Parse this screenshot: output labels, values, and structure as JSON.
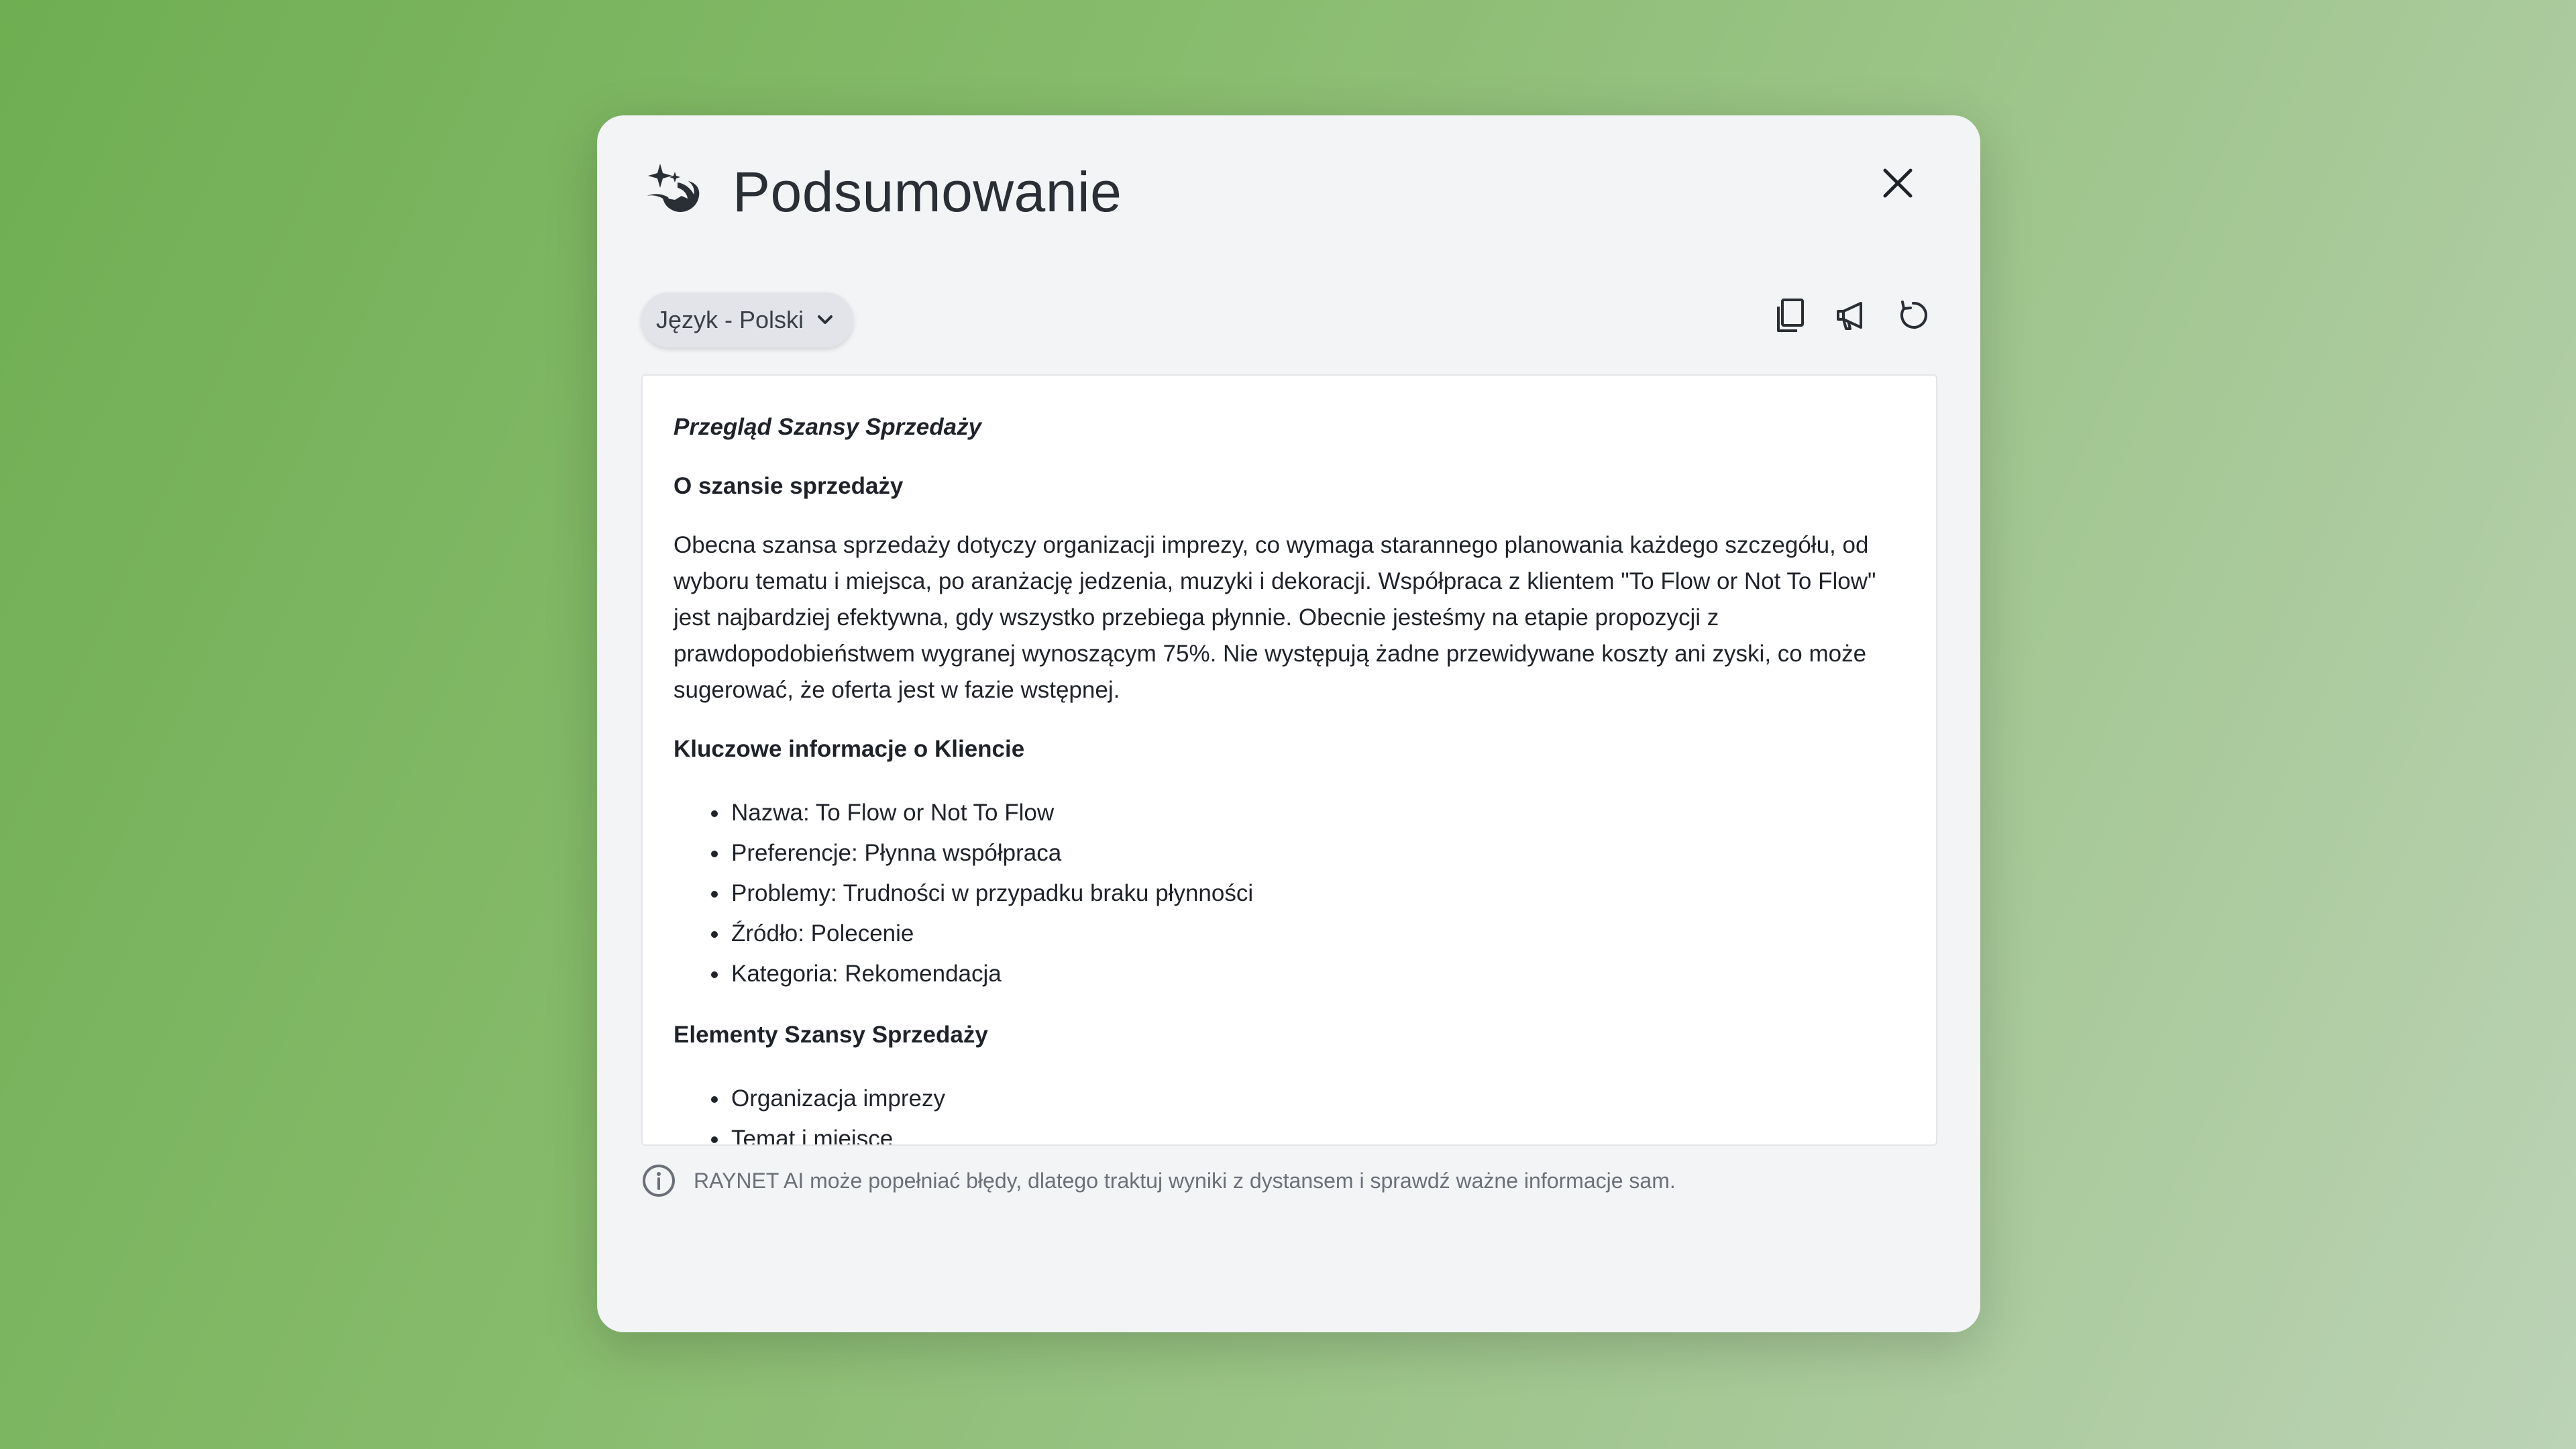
{
  "dialog": {
    "title": "Podsumowanie",
    "icons": {
      "title": "ai-sparkle-icon",
      "close": "close-icon"
    }
  },
  "toolbar": {
    "language_label": "Język - Polski",
    "icons": [
      "copy-icon",
      "megaphone-icon",
      "refresh-icon"
    ]
  },
  "summary": {
    "doc_title": "Przegląd Szansy Sprzedaży",
    "section1_heading": "O szansie sprzedaży",
    "section1_text": "Obecna szansa sprzedaży dotyczy organizacji imprezy, co wymaga starannego planowania każdego szczegółu, od wyboru tematu i miejsca, po aranżację jedzenia, muzyki i dekoracji. Współpraca z klientem \"To Flow or Not To Flow\" jest najbardziej efektywna, gdy wszystko przebiega płynnie. Obecnie jesteśmy na etapie propozycji z prawdopodobieństwem wygranej wynoszącym 75%. Nie występują żadne przewidywane koszty ani zyski, co może sugerować, że oferta jest w fazie wstępnej.",
    "section2_heading": "Kluczowe informacje o Kliencie",
    "section2_items": [
      "Nazwa: To Flow or Not To Flow",
      "Preferencje: Płynna współpraca",
      "Problemy: Trudności w przypadku braku płynności",
      "Źródło: Polecenie",
      "Kategoria: Rekomendacja"
    ],
    "section3_heading": "Elementy Szansy Sprzedaży",
    "section3_items": [
      "Organizacja imprezy",
      "Temat i miejsce"
    ]
  },
  "footer": {
    "disclaimer": "RAYNET AI może popełniać błędy, dlatego traktuj wyniki z dystansem i sprawdź ważne informacje sam.",
    "icon": "info-icon"
  },
  "colors": {
    "background": "#86bb6b",
    "modal": "#f3f4f6",
    "text": "#1f2329",
    "muted": "#6b7078"
  }
}
